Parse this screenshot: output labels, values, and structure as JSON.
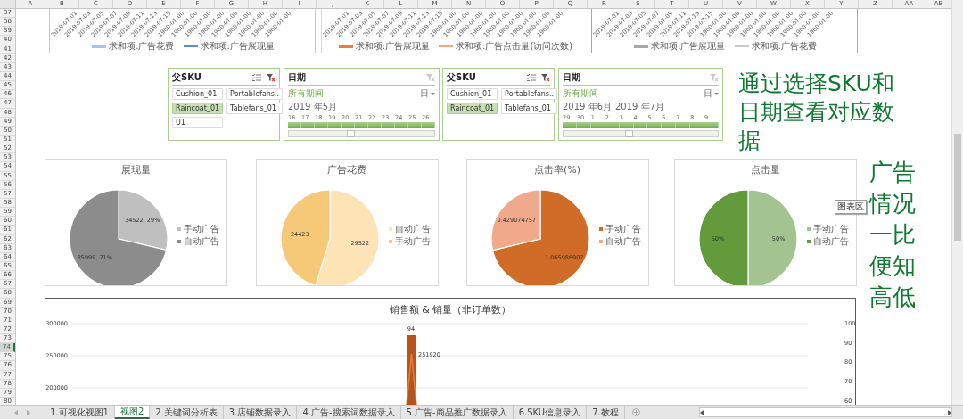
{
  "columns": [
    "A",
    "B",
    "C",
    "D",
    "E",
    "F",
    "G",
    "H",
    "I",
    "J",
    "K",
    "L",
    "M",
    "N",
    "O",
    "P",
    "Q",
    "R",
    "S",
    "T",
    "U",
    "V",
    "W",
    "X",
    "Y",
    "Z",
    "AA",
    "AB"
  ],
  "rows": [
    {
      "label": "37",
      "selected": false
    },
    {
      "label": "38",
      "selected": false
    },
    {
      "label": "39",
      "selected": false
    },
    {
      "label": "40",
      "selected": false
    },
    {
      "label": "41",
      "selected": false
    },
    {
      "label": "42",
      "selected": false
    },
    {
      "label": "43",
      "selected": false
    },
    {
      "label": "44",
      "selected": false
    },
    {
      "label": "45",
      "selected": false
    },
    {
      "label": "46",
      "selected": false
    },
    {
      "label": "47",
      "selected": false
    },
    {
      "label": "48",
      "selected": false
    },
    {
      "label": "49",
      "selected": false
    },
    {
      "label": "50",
      "selected": false
    },
    {
      "label": "51",
      "selected": false
    },
    {
      "label": "52",
      "selected": false
    },
    {
      "label": "53",
      "selected": false
    },
    {
      "label": "54",
      "selected": false
    },
    {
      "label": "55",
      "selected": false
    },
    {
      "label": "56",
      "selected": false
    },
    {
      "label": "57",
      "selected": false
    },
    {
      "label": "58",
      "selected": false
    },
    {
      "label": "59",
      "selected": false
    },
    {
      "label": "60",
      "selected": false
    },
    {
      "label": "61",
      "selected": false
    },
    {
      "label": "62",
      "selected": false
    },
    {
      "label": "63",
      "selected": false
    },
    {
      "label": "64",
      "selected": false
    },
    {
      "label": "65",
      "selected": false
    },
    {
      "label": "66",
      "selected": false
    },
    {
      "label": "67",
      "selected": false
    },
    {
      "label": "68",
      "selected": false
    },
    {
      "label": "69",
      "selected": false
    },
    {
      "label": "70",
      "selected": false
    },
    {
      "label": "71",
      "selected": false
    },
    {
      "label": "72",
      "selected": false
    },
    {
      "label": "73",
      "selected": false
    },
    {
      "label": "74",
      "selected": true
    },
    {
      "label": "75",
      "selected": false
    },
    {
      "label": "76",
      "selected": false
    },
    {
      "label": "77",
      "selected": false
    },
    {
      "label": "78",
      "selected": false
    },
    {
      "label": "79",
      "selected": false
    },
    {
      "label": "80",
      "selected": false
    }
  ],
  "top_charts": [
    {
      "color": "#c9c9c9",
      "x_labels": [
        "2019-07-01",
        "2019-07-03",
        "2019-07-05",
        "2019-07-07",
        "2019-07-09",
        "2019-07-11",
        "2019-07-13",
        "2019-07-15",
        "1900-01-00",
        "1900-01-00",
        "1900-01-00",
        "1900-01-00",
        "1900-01-00",
        "1900-01-00",
        "1900-01-00",
        "1900-01-00",
        "1900-01-00"
      ],
      "legend": [
        {
          "kind": "bar",
          "label": "求和项:广告花费",
          "color": "#a9c4e8"
        },
        {
          "kind": "line",
          "label": "求和项:广告展现量",
          "color": "#5b8bd0"
        }
      ]
    },
    {
      "color": "#ffd966",
      "x_labels": [
        "2019-07-01",
        "2019-07-03",
        "2019-07-05",
        "2019-07-07",
        "2019-07-09",
        "2019-07-11",
        "2019-07-13",
        "2019-07-15",
        "1900-01-00",
        "1900-01-00",
        "1900-01-00",
        "1900-01-00",
        "1900-01-00",
        "1900-01-00",
        "1900-01-00",
        "1900-01-00",
        "1900-01-00"
      ],
      "legend": [
        {
          "kind": "bar",
          "label": "求和项:广告展现量",
          "color": "#ed7d31"
        },
        {
          "kind": "line",
          "label": "求和项:广告点击量(访问次数)",
          "color": "#f4a582"
        }
      ]
    },
    {
      "color": "#8faadc",
      "x_labels": [
        "2019-07-01",
        "2019-07-03",
        "2019-07-05",
        "2019-07-07",
        "2019-07-09",
        "2019-07-11",
        "2019-07-13",
        "2019-07-15",
        "1900-01-00",
        "1900-01-00",
        "1900-01-00",
        "1900-01-00",
        "1900-01-00",
        "1900-01-00",
        "1900-01-00",
        "1900-01-00",
        "1900-01-00"
      ],
      "legend": [
        {
          "kind": "bar",
          "label": "求和项:广告展现量",
          "color": "#a5a5a5"
        },
        {
          "kind": "line",
          "label": "求和项:广告花费",
          "color": "#c9c9c9"
        }
      ]
    }
  ],
  "slicers": [
    {
      "kind": "sku",
      "title": "父SKU",
      "filter_active": true,
      "items": [
        {
          "label": "Cushion_01",
          "selected": false
        },
        {
          "label": "Portablefans..",
          "selected": false
        },
        {
          "label": "Raincoat_01",
          "selected": true
        },
        {
          "label": "Tablefans_01",
          "selected": false
        },
        {
          "label": "U1",
          "selected": false
        }
      ]
    },
    {
      "kind": "timeline",
      "title": "日期",
      "filter_active": false,
      "period": "所有期间",
      "unit": "日",
      "months": [
        "2019 年5月"
      ],
      "days": [
        {
          "label": "16",
          "selected": true
        },
        {
          "label": "17",
          "selected": true
        },
        {
          "label": "18",
          "selected": true
        },
        {
          "label": "19",
          "selected": true
        },
        {
          "label": "20",
          "selected": true
        },
        {
          "label": "21",
          "selected": true
        },
        {
          "label": "22",
          "selected": true
        },
        {
          "label": "23",
          "selected": true
        },
        {
          "label": "24",
          "selected": true
        },
        {
          "label": "25",
          "selected": true
        },
        {
          "label": "26",
          "selected": true
        }
      ]
    },
    {
      "kind": "sku",
      "title": "父SKU",
      "filter_active": true,
      "items": [
        {
          "label": "Cushion_01",
          "selected": false
        },
        {
          "label": "Portablefans..",
          "selected": false
        },
        {
          "label": "Raincoat_01",
          "selected": true
        },
        {
          "label": "Tablefans_01",
          "selected": false
        }
      ]
    },
    {
      "kind": "timeline",
      "title": "日期",
      "filter_active": false,
      "period": "所有期间",
      "unit": "日",
      "months": [
        "2019 年6月",
        "2019 年7月"
      ],
      "days": [
        {
          "label": "29",
          "selected": true
        },
        {
          "label": "30",
          "selected": true
        },
        {
          "label": "1",
          "selected": true
        },
        {
          "label": "2",
          "selected": true
        },
        {
          "label": "3",
          "selected": true
        },
        {
          "label": "4",
          "selected": true
        },
        {
          "label": "5",
          "selected": true
        },
        {
          "label": "6",
          "selected": true
        },
        {
          "label": "7",
          "selected": true
        },
        {
          "label": "8",
          "selected": true
        },
        {
          "label": "9",
          "selected": true
        }
      ]
    }
  ],
  "notes": [
    {
      "kind": "wrap",
      "text": "通过选择SKU和日期查看对应数据"
    },
    {
      "kind": "column",
      "text": "广告情况一比便知高低"
    }
  ],
  "tooltip": "图表区",
  "pie_charts": [
    {
      "chart_data": {
        "type": "pie",
        "title": "展现量",
        "categories": [
          "手动广告",
          "自动广告"
        ],
        "values": [
          34522,
          85999
        ],
        "colors": [
          "#bfbfbf",
          "#8c8c8c"
        ],
        "value_labels": [
          "34522, 29%",
          "85999, 71%"
        ],
        "legend": "right"
      }
    },
    {
      "chart_data": {
        "type": "pie",
        "title": "广告花费",
        "categories": [
          "自动广告",
          "手动广告"
        ],
        "values": [
          29522,
          24423
        ],
        "colors": [
          "#fde4b7",
          "#f6c978"
        ],
        "value_labels": [
          "29522",
          "24423"
        ],
        "legend": "right"
      }
    },
    {
      "chart_data": {
        "type": "pie",
        "title": "点击率(%)",
        "categories": [
          "手动广告",
          "自动广告"
        ],
        "values": [
          1.065986907,
          0.429074757
        ],
        "colors": [
          "#d06b28",
          "#f0a98a"
        ],
        "value_labels": [
          "1.065986907",
          "0.429074757"
        ],
        "legend": "right"
      }
    },
    {
      "chart_data": {
        "type": "pie",
        "title": "点击量",
        "categories": [
          "手动广告",
          "自动广告"
        ],
        "values": [
          50,
          50
        ],
        "colors": [
          "#a3c490",
          "#629a3c"
        ],
        "value_labels": [
          "50%",
          "50%"
        ],
        "legend": "right"
      }
    }
  ],
  "combo_chart": {
    "title": "销售额 & 销量（非订单数）",
    "left_ticks": [
      "300000",
      "250000",
      "200000"
    ],
    "right_ticks": [
      "100",
      "90",
      "80",
      "70",
      "60"
    ],
    "bar_label": "94",
    "point_label": "251920"
  },
  "sheet_tabs": [
    {
      "label": "1.可视化视图1",
      "selected": false
    },
    {
      "label": "视图2",
      "selected": true
    },
    {
      "label": "2.关键词分析表",
      "selected": false
    },
    {
      "label": "3.店铺数据录入",
      "selected": false
    },
    {
      "label": "4.广告-搜索词数据录入",
      "selected": false
    },
    {
      "label": "5.广告-商品推广数据录入",
      "selected": false
    },
    {
      "label": "6.SKU信息录入",
      "selected": false
    },
    {
      "label": "7.教程",
      "selected": false
    }
  ]
}
